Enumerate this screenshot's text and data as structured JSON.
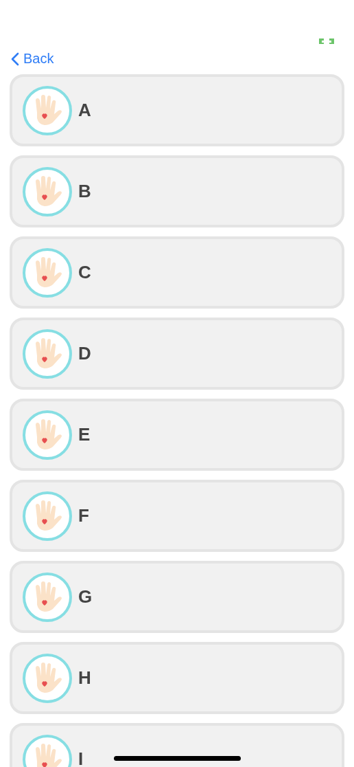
{
  "nav": {
    "back": "Back"
  },
  "items": [
    {
      "label": "A"
    },
    {
      "label": "B"
    },
    {
      "label": "C"
    },
    {
      "label": "D"
    },
    {
      "label": "E"
    },
    {
      "label": "F"
    },
    {
      "label": "G"
    },
    {
      "label": "H"
    },
    {
      "label": "I"
    }
  ]
}
